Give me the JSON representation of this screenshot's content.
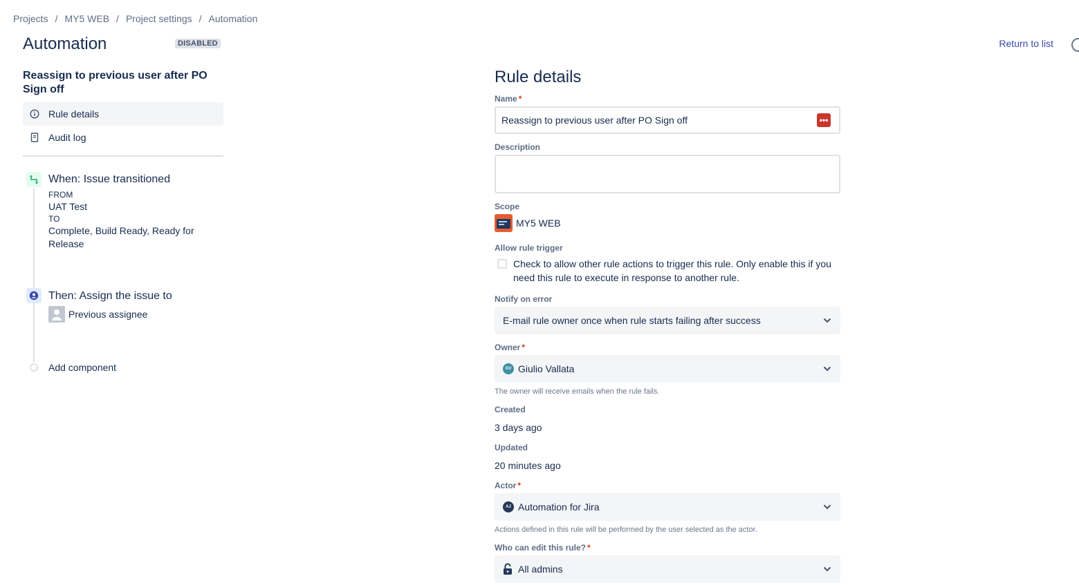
{
  "breadcrumb": {
    "items": [
      "Projects",
      "MY5 WEB",
      "Project settings",
      "Automation"
    ],
    "separator": "/"
  },
  "header": {
    "title": "Automation",
    "status_badge": "DISABLED",
    "return_link": "Return to list"
  },
  "rule_panel": {
    "rule_name": "Reassign to previous user after PO Sign off",
    "nav": [
      {
        "label": "Rule details",
        "icon": "info-icon",
        "active": true
      },
      {
        "label": "Audit log",
        "icon": "document-icon",
        "active": false
      }
    ],
    "trigger": {
      "title": "When: Issue transitioned",
      "from_label": "FROM",
      "from_value": "UAT Test",
      "to_label": "TO",
      "to_value": "Complete, Build Ready, Ready for Release"
    },
    "action": {
      "title": "Then: Assign the issue to",
      "assignee": "Previous assignee"
    },
    "add_component": "Add component"
  },
  "form": {
    "title": "Rule details",
    "name": {
      "label": "Name",
      "required_mark": "*",
      "value": "Reassign to previous user after PO Sign off"
    },
    "description": {
      "label": "Description",
      "value": ""
    },
    "scope": {
      "label": "Scope",
      "value": "MY5 WEB"
    },
    "allow_trigger": {
      "label": "Allow rule trigger",
      "text": "Check to allow other rule actions to trigger this rule. Only enable this if you need this rule to execute in response to another rule.",
      "checked": false
    },
    "notify": {
      "label": "Notify on error",
      "value": "E-mail rule owner once when rule starts failing after success"
    },
    "owner": {
      "label": "Owner",
      "required_mark": "*",
      "value": "Giulio Vallata",
      "initials": "GV",
      "helper": "The owner will receive emails when the rule fails."
    },
    "created": {
      "label": "Created",
      "value": "3 days ago"
    },
    "updated": {
      "label": "Updated",
      "value": "20 minutes ago"
    },
    "actor": {
      "label": "Actor",
      "required_mark": "*",
      "value": "Automation for Jira",
      "initials": "AJ",
      "helper": "Actions defined in this rule will be performed by the user selected as the actor."
    },
    "edit_permission": {
      "label": "Who can edit this rule?",
      "required_mark": "*",
      "value": "All admins",
      "icon": "lock-icon"
    }
  },
  "colors": {
    "accent": "#3949ab",
    "badge_bg": "#dfe1e6",
    "required": "#de350b",
    "select_bg": "#f4f5f7",
    "project_avatar": "#e25d33"
  }
}
